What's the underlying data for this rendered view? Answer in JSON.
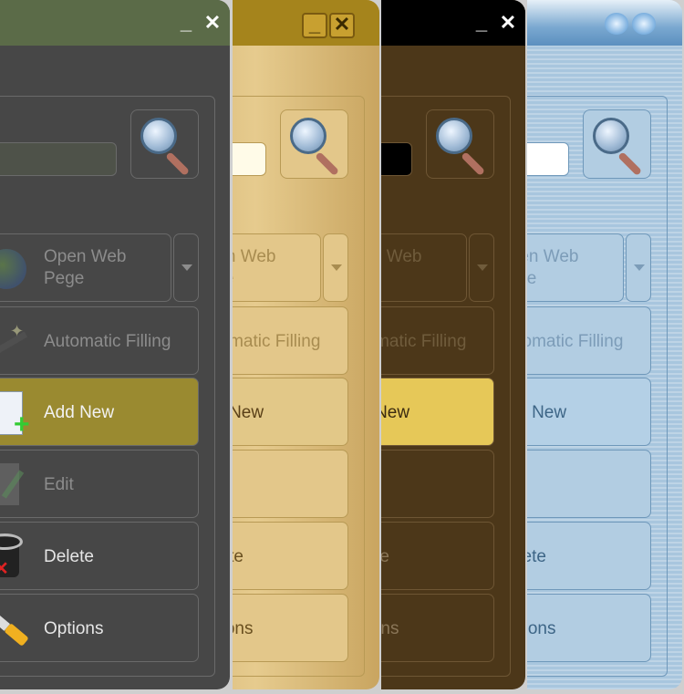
{
  "toolbar": {
    "search_icon": "magnifier-icon",
    "buttons": [
      {
        "key": "open",
        "label": "Open Web\nPege",
        "icon": "globe-icon",
        "enabled": false
      },
      {
        "key": "fill",
        "label": "Automatic Filling",
        "icon": "magic-wand-icon",
        "enabled": false
      },
      {
        "key": "add",
        "label": "Add New",
        "icon": "add-document-icon",
        "enabled": true,
        "highlighted": true
      },
      {
        "key": "edit",
        "label": "Edit",
        "icon": "edit-icon",
        "enabled": false
      },
      {
        "key": "delete",
        "label": "Delete",
        "icon": "trash-icon",
        "enabled": true
      },
      {
        "key": "options",
        "label": "Options",
        "icon": "wrench-icon",
        "enabled": true
      }
    ],
    "minimize_label": "_",
    "close_label": "✕"
  },
  "skins": [
    {
      "name": "gray",
      "bg": "#474747",
      "title": "#5b6b48",
      "frame": "#6a6a6a",
      "input": "#4e5249",
      "text": "#e6e6e6",
      "dim": "#8c8c8c",
      "hl": "#9a8a30",
      "hlText": "#f2f2f2",
      "btnBg": "transparent"
    },
    {
      "name": "gold",
      "bg": "#dcbb78",
      "title": "#a5841c",
      "frame": "#b89a55",
      "input": "#fffbe8",
      "text": "#6a5020",
      "dim": "#a88c50",
      "hl": "#e2c888",
      "hlText": "#5a4018",
      "btnBg": "#e3c78a"
    },
    {
      "name": "brown",
      "bg": "#4c3719",
      "title": "#000000",
      "frame": "#6e5634",
      "input": "#000000",
      "text": "#8a7658",
      "dim": "#705c3c",
      "hl": "#e6c858",
      "hlText": "#3a2a10",
      "btnBg": "transparent"
    },
    {
      "name": "blue",
      "bg": "#a8c6de",
      "title": "#6a9cc6",
      "frame": "#6f98ba",
      "input": "#ffffff",
      "text": "#3d6586",
      "dim": "#7c9cb8",
      "hl": "#b4d0e6",
      "hlText": "#3d6586",
      "btnBg": "#b2cde2"
    }
  ]
}
